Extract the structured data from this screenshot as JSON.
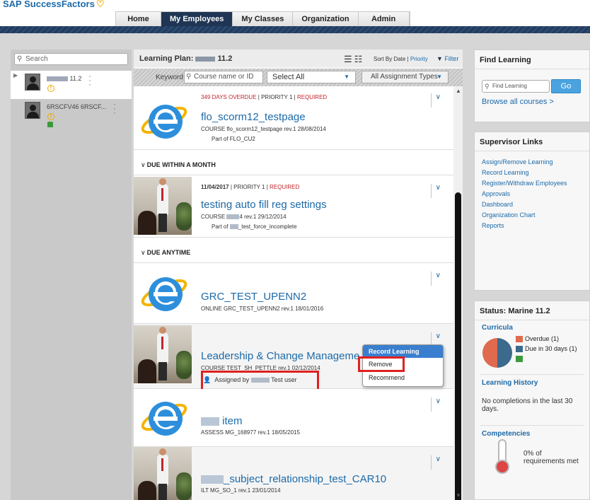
{
  "brand": "SAP SuccessFactors",
  "nav": {
    "tabs": [
      "Home",
      "My Employees",
      "My Classes",
      "Organization",
      "Admin"
    ],
    "active": "My Employees"
  },
  "left": {
    "search_placeholder": "Search",
    "employees": [
      {
        "name_suffix": "11.2"
      },
      {
        "name": "6RSCFV46 6RSCF..."
      }
    ]
  },
  "main": {
    "learning_plan_label": "Learning Plan:",
    "learning_plan_suffix": "11.2",
    "sort_by": "Sort By Date |",
    "sort_priority": "Priority",
    "filter_label": "Filter",
    "keyword_label": "Keyword",
    "keyword_placeholder": "Course name or ID",
    "select_all": "Select All",
    "assignment_types": "All Assignment Types",
    "sections": {
      "month": "DUE WITHIN A MONTH",
      "anytime": "DUE ANYTIME"
    },
    "items": [
      {
        "overdue": "349 DAYS OVERDUE",
        "priority": "PRIORITY 1",
        "required": "REQUIRED",
        "title": "flo_scorm12_testpage",
        "sub": "COURSE flo_scorm12_testpage rev.1 28/08/2014",
        "part": "Part of FLO_CU2"
      },
      {
        "date": "11/04/2017",
        "priority": "PRIORITY 1",
        "required": "REQUIRED",
        "title": "testing auto fill reg settings",
        "sub_prefix": "COURSE",
        "sub_suffix": "4 rev.1 29/12/2014",
        "part_prefix": "Part of",
        "part_suffix": "_test_force_incomplete"
      },
      {
        "title": "GRC_TEST_UPENN2",
        "sub": "ONLINE GRC_TEST_UPENN2 rev.1 18/01/2016"
      },
      {
        "title": "Leadership & Change Manageme",
        "sub": "COURSE TEST_SH_PETTLE rev.1 02/12/2014",
        "assigned_prefix": "Assigned by",
        "assigned_suffix": "Test user"
      },
      {
        "title": "item",
        "sub": "ASSESS MG_168977 rev.1 18/05/2015"
      },
      {
        "title": "_subject_relationship_test_CAR10",
        "sub": "ILT MG_SO_1 rev.1 23/01/2014"
      }
    ],
    "menu": [
      "Record Learning",
      "Remove",
      "Recommend"
    ]
  },
  "right": {
    "find": {
      "heading": "Find Learning",
      "placeholder": "Find Learning",
      "go": "Go",
      "browse": "Browse all courses >"
    },
    "supervisor": {
      "heading": "Supervisor Links",
      "links": [
        "Assign/Remove Learning",
        "Record Learning",
        "Register/Withdraw Employees",
        "Approvals",
        "Dashboard",
        "Organization Chart",
        "Reports"
      ]
    },
    "status": {
      "heading": "Status: Marine 11.2",
      "curricula": "Curricula",
      "legend": [
        {
          "label": "Overdue (1)",
          "color": "#e06a4e"
        },
        {
          "label": "Due in 30 days (1)",
          "color": "#3b6a8c"
        },
        {
          "label": "",
          "color": "#3c9a3c"
        }
      ],
      "pie": {
        "overdue": 1,
        "due_30": 1
      },
      "history": "Learning History",
      "no_completions": "No completions in the last 30 days.",
      "competencies": "Competencies",
      "requirements": "0% of requirements met"
    }
  },
  "colors": {
    "accent": "#1c6aa8",
    "nav_active": "#1f3553",
    "required": "#c0262c",
    "go": "#4aa3df"
  }
}
